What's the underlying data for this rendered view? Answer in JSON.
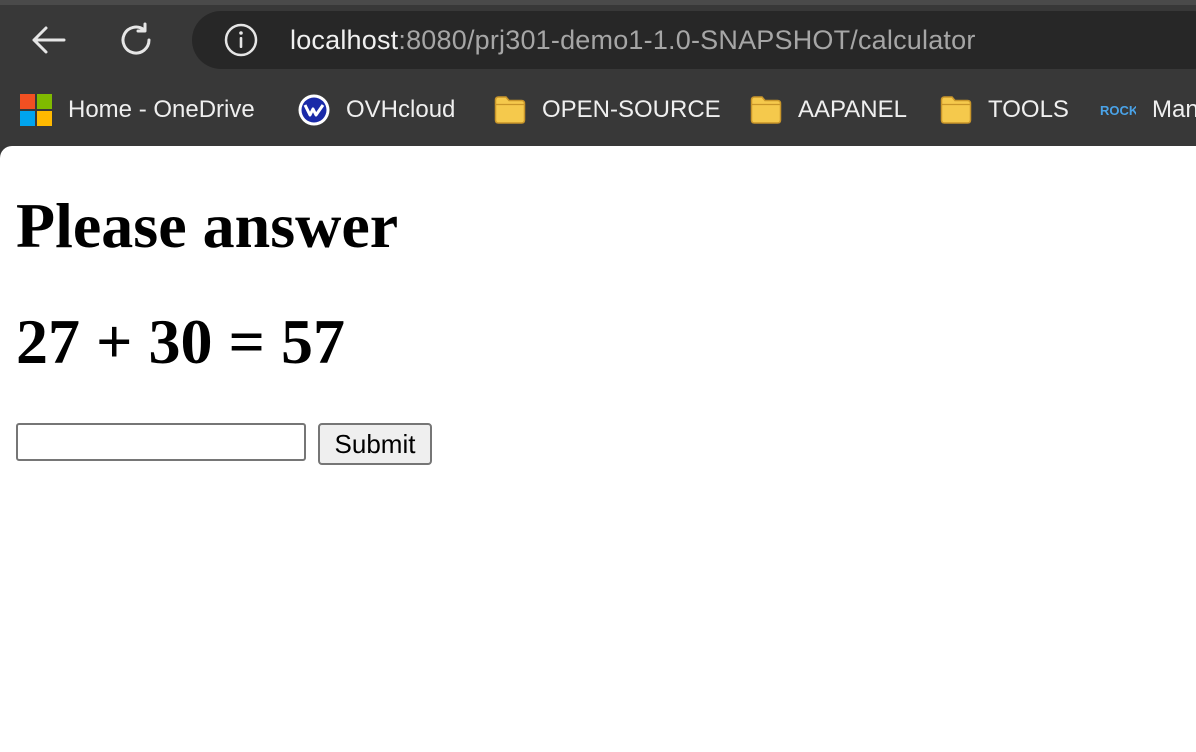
{
  "browser": {
    "url_host": "localhost",
    "url_rest": ":8080/prj301-demo1-1.0-SNAPSHOT/calculator"
  },
  "bookmarks": [
    {
      "label": "Home - OneDrive",
      "icon": "microsoft-logo-icon"
    },
    {
      "label": "OVHcloud",
      "icon": "ovhcloud-logo-icon"
    },
    {
      "label": "OPEN-SOURCE",
      "icon": "folder-icon"
    },
    {
      "label": "AAPANEL",
      "icon": "folder-icon"
    },
    {
      "label": "TOOLS",
      "icon": "folder-icon"
    },
    {
      "label": "Man",
      "icon": "rock-logo-icon",
      "icon_text": "ROCK"
    }
  ],
  "page": {
    "title": "Please answer",
    "question": "27 + 30 = 57",
    "answer_value": "",
    "submit_label": "Submit"
  },
  "colors": {
    "toolbar_bg": "#383838",
    "address_bg": "#272727",
    "folder_yellow": "#f5c94c"
  }
}
